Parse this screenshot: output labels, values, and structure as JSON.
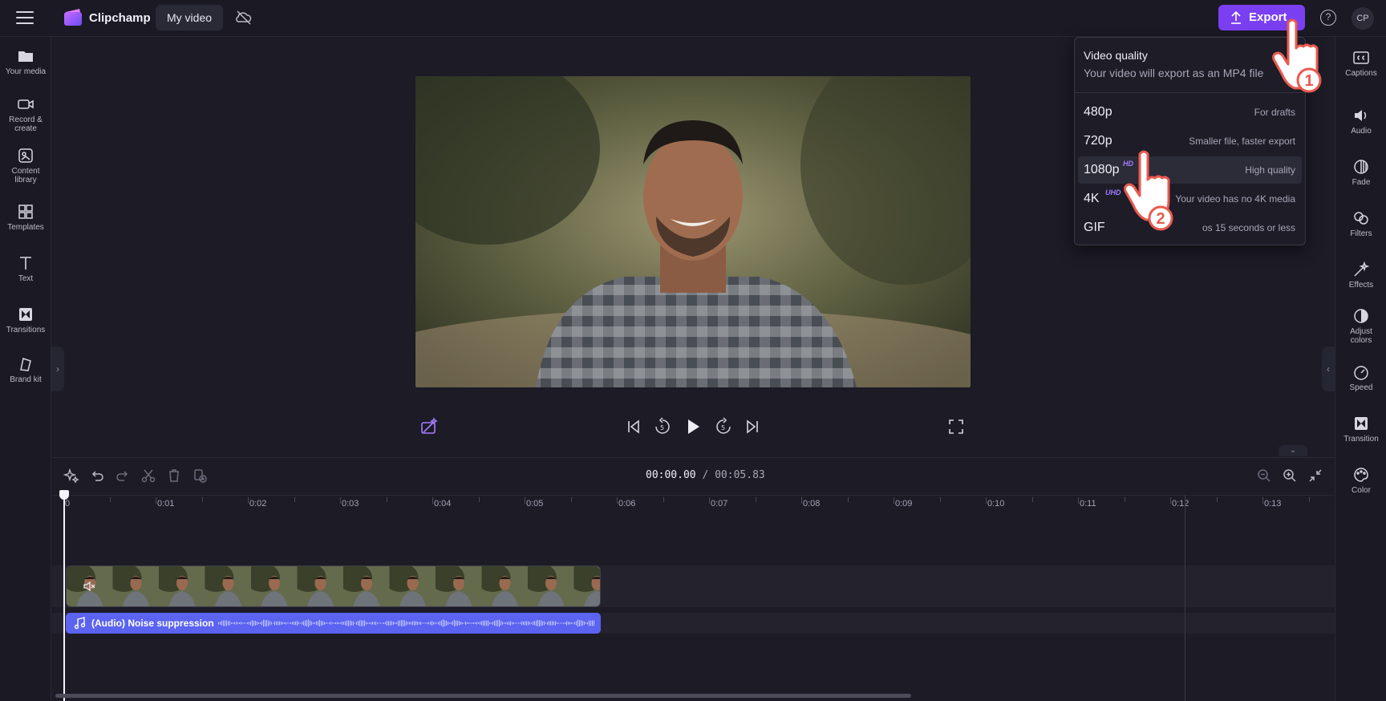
{
  "topbar": {
    "brand": "Clipchamp",
    "project_name": "My video",
    "export_label": "Export",
    "help": "?",
    "avatar_initials": "CP"
  },
  "left_sidebar": {
    "items": [
      {
        "label": "Your media"
      },
      {
        "label": "Record &",
        "label2": "create"
      },
      {
        "label": "Content",
        "label2": "library"
      },
      {
        "label": "Templates"
      },
      {
        "label": "Text"
      },
      {
        "label": "Transitions"
      },
      {
        "label": "Brand kit"
      }
    ]
  },
  "right_sidebar": {
    "items": [
      {
        "label": "Captions"
      },
      {
        "label": "Audio"
      },
      {
        "label": "Fade"
      },
      {
        "label": "Filters"
      },
      {
        "label": "Effects"
      },
      {
        "label": "Adjust",
        "label2": "colors"
      },
      {
        "label": "Speed"
      },
      {
        "label": "Transition"
      },
      {
        "label": "Color"
      }
    ]
  },
  "export_menu": {
    "title": "Video quality",
    "subtitle": "Your video will export as an MP4 file",
    "options": [
      {
        "quality": "480p",
        "badge": "",
        "description": "For drafts"
      },
      {
        "quality": "720p",
        "badge": "",
        "description": "Smaller file, faster export"
      },
      {
        "quality": "1080p",
        "badge": "HD",
        "description": "High quality"
      },
      {
        "quality": "4K",
        "badge": "UHD",
        "description": "Your video has no 4K media"
      },
      {
        "quality": "GIF",
        "badge": "",
        "description": "os 15 seconds or less"
      }
    ],
    "selected_index": 2
  },
  "timeline": {
    "current_time": "00:00.00",
    "total_time": "/ 00:05.83",
    "ruler_labels": [
      "0",
      "0:01",
      "0:02",
      "0:03",
      "0:04",
      "0:05",
      "0:06",
      "0:07",
      "0:08",
      "0:09",
      "0:10",
      "0:11",
      "0:12",
      "0:13"
    ],
    "audio_clip_name": "(Audio) Noise suppression"
  },
  "step_callouts": [
    "1",
    "2"
  ],
  "colors": {
    "accent": "#7b3ff2",
    "audio_clip": "#5b63f0",
    "badge": "#a57bff",
    "callout": "#e85a4f"
  }
}
